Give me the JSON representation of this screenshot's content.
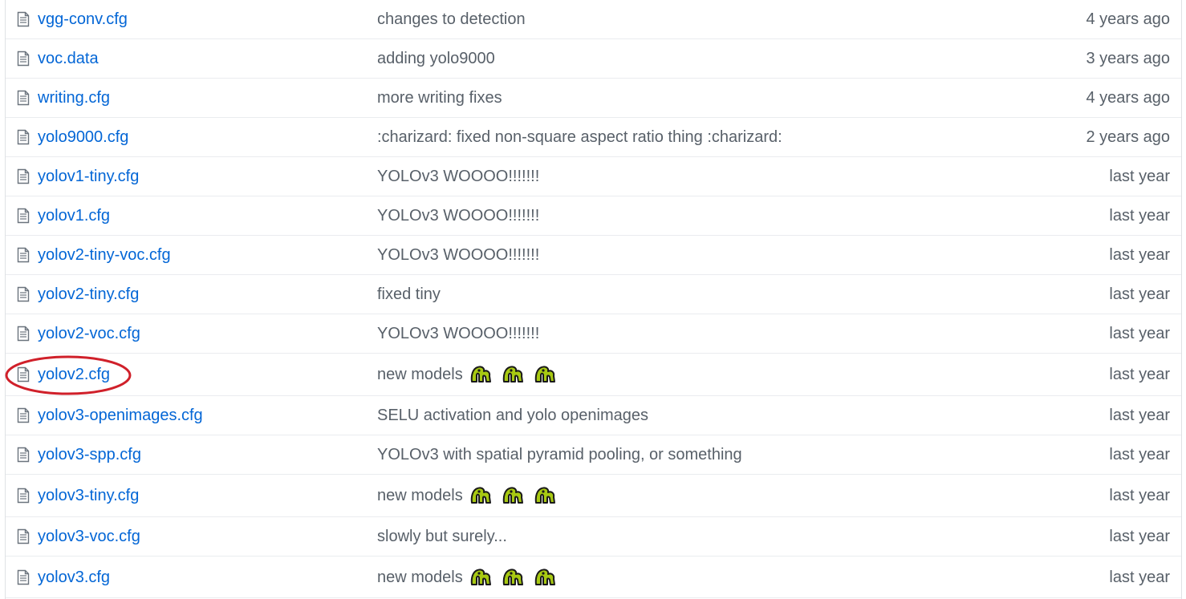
{
  "files": [
    {
      "name": "vgg-conv.cfg",
      "message": "changes to detection",
      "age": "4 years ago"
    },
    {
      "name": "voc.data",
      "message": "adding yolo9000",
      "age": "3 years ago"
    },
    {
      "name": "writing.cfg",
      "message": "more writing fixes",
      "age": "4 years ago"
    },
    {
      "name": "yolo9000.cfg",
      "message": ":charizard: fixed non-square aspect ratio thing :charizard:",
      "age": "2 years ago"
    },
    {
      "name": "yolov1-tiny.cfg",
      "message": "YOLOv3 WOOOO!!!!!!!",
      "age": "last year"
    },
    {
      "name": "yolov1.cfg",
      "message": "YOLOv3 WOOOO!!!!!!!",
      "age": "last year"
    },
    {
      "name": "yolov2-tiny-voc.cfg",
      "message": "YOLOv3 WOOOO!!!!!!!",
      "age": "last year"
    },
    {
      "name": "yolov2-tiny.cfg",
      "message": "fixed tiny",
      "age": "last year"
    },
    {
      "name": "yolov2-voc.cfg",
      "message": "YOLOv3 WOOOO!!!!!!!",
      "age": "last year"
    },
    {
      "name": "yolov2.cfg",
      "message": "new models",
      "emoji_count": 3,
      "age": "last year",
      "highlighted": true
    },
    {
      "name": "yolov3-openimages.cfg",
      "message": "SELU activation and yolo openimages",
      "age": "last year"
    },
    {
      "name": "yolov3-spp.cfg",
      "message": "YOLOv3 with spatial pyramid pooling, or something",
      "age": "last year"
    },
    {
      "name": "yolov3-tiny.cfg",
      "message": "new models",
      "emoji_count": 3,
      "age": "last year"
    },
    {
      "name": "yolov3-voc.cfg",
      "message": "slowly but surely...",
      "age": "last year"
    },
    {
      "name": "yolov3.cfg",
      "message": "new models",
      "emoji_count": 3,
      "age": "last year"
    }
  ],
  "icons": {
    "file": "file-text-icon",
    "emoji": "emoji-icon"
  },
  "colors": {
    "link": "#0366d6",
    "muted": "#586069",
    "highlight_ring": "#d0202a",
    "emoji_fill": "#a8c912"
  }
}
